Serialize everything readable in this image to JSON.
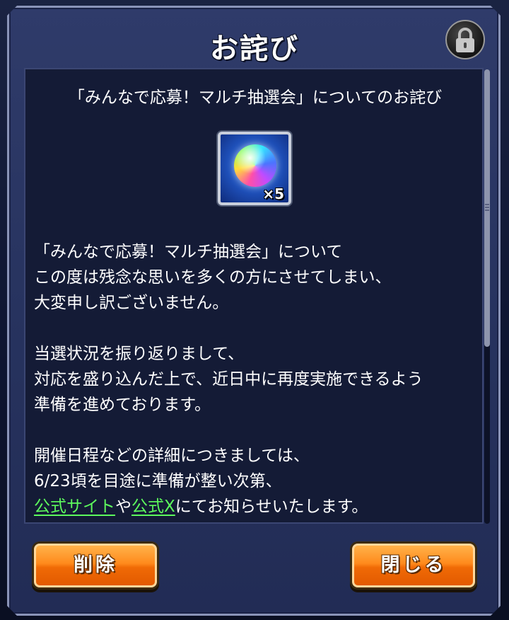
{
  "dialog": {
    "title": "お詫び",
    "lock_icon": "lock-icon"
  },
  "content": {
    "subtitle": "「みんなで応募！マルチ抽選会」についてのお詫び",
    "reward": {
      "icon": "rainbow-orb-icon",
      "quantity": "×5"
    },
    "paragraphs": [
      [
        "「みんなで応募！マルチ抽選会」について",
        "この度は残念な思いを多くの方にさせてしまい、",
        "大変申し訳ございません。"
      ],
      [
        "当選状況を振り返りまして、",
        "対応を盛り込んだ上で、近日中に再度実施できるよう",
        "準備を進めております。"
      ]
    ],
    "para3": {
      "line1": "開催日程などの詳細につきましては、",
      "line2": "6/23頃を目途に準備が整い次第、",
      "link1": "公式サイト",
      "mid": "や",
      "link2": "公式X",
      "tail": "にてお知らせいたします。"
    }
  },
  "buttons": {
    "delete": "削除",
    "close": "閉じる"
  },
  "colors": {
    "panel": "#2f3b6a",
    "content_bg": "#141b36",
    "link": "#5dfa5d",
    "button": "#ff8a1c"
  }
}
